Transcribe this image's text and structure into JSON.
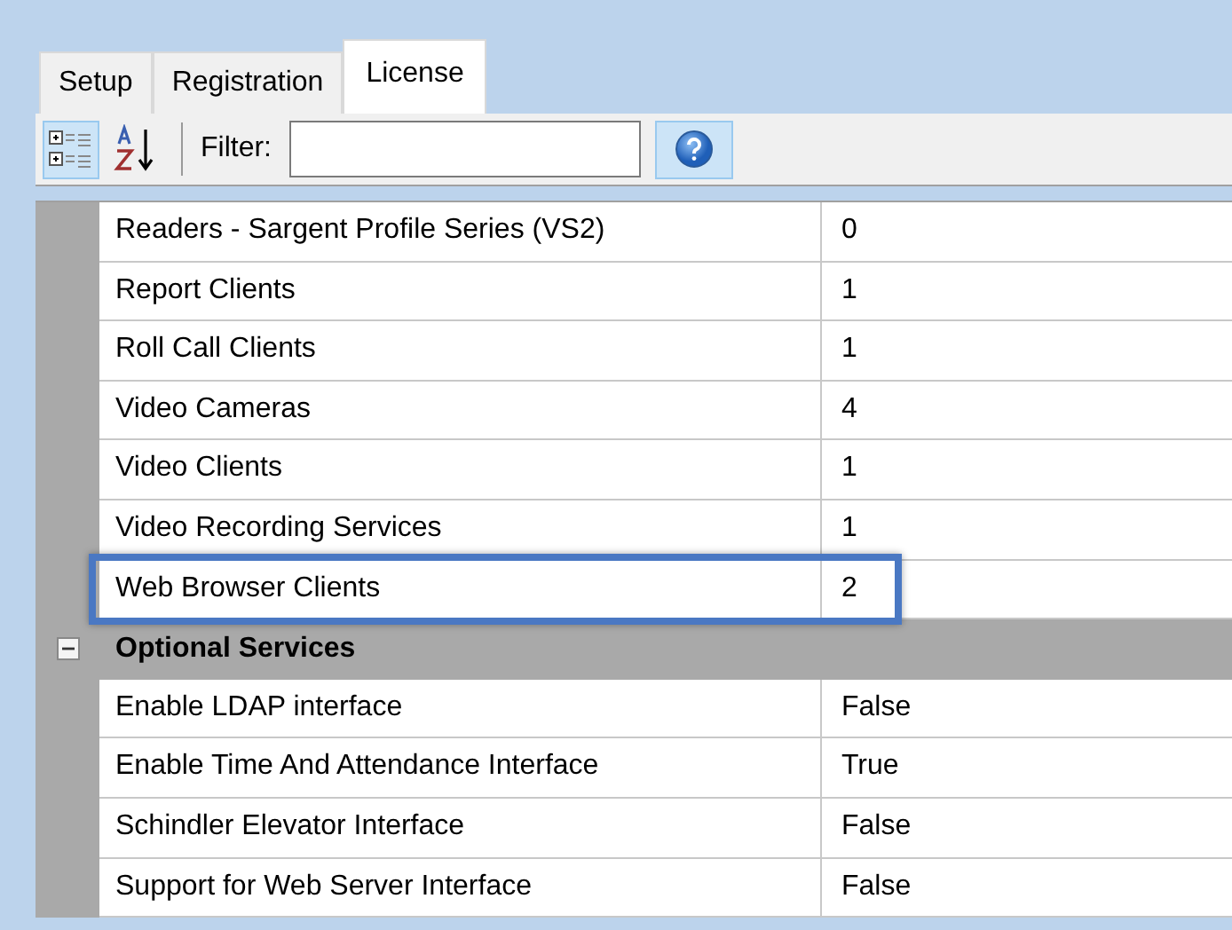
{
  "tabs": [
    {
      "label": "Setup",
      "selected": false
    },
    {
      "label": "Registration",
      "selected": false
    },
    {
      "label": "License",
      "selected": true
    }
  ],
  "toolbar": {
    "view_buttons": [
      {
        "kind": "categorized",
        "selected": true
      },
      {
        "kind": "alphabetical",
        "selected": false
      }
    ],
    "filter_label": "Filter:"
  },
  "properties": [
    {
      "kind": "property",
      "name": "Readers - Sargent Profile Series (VS2)",
      "value": "0",
      "highlighted": false
    },
    {
      "kind": "property",
      "name": "Report Clients",
      "value": "1",
      "highlighted": false
    },
    {
      "kind": "property",
      "name": "Roll Call Clients",
      "value": "1",
      "highlighted": false
    },
    {
      "kind": "property",
      "name": "Video Cameras",
      "value": "4",
      "highlighted": false
    },
    {
      "kind": "property",
      "name": "Video Clients",
      "value": "1",
      "highlighted": false
    },
    {
      "kind": "property",
      "name": "Video Recording Services",
      "value": "1",
      "highlighted": false
    },
    {
      "kind": "property",
      "name": "Web Browser Clients",
      "value": "2",
      "highlighted": true
    },
    {
      "kind": "category",
      "name": "Optional Services",
      "expanded": true
    },
    {
      "kind": "property",
      "name": "Enable LDAP interface",
      "value": "False",
      "highlighted": false
    },
    {
      "kind": "property",
      "name": "Enable Time And Attendance Interface",
      "value": "True",
      "highlighted": false
    },
    {
      "kind": "property",
      "name": "Schindler Elevator Interface",
      "value": "False",
      "highlighted": false
    },
    {
      "kind": "property",
      "name": "Support for Web Server Interface",
      "value": "False",
      "highlighted": false
    }
  ]
}
